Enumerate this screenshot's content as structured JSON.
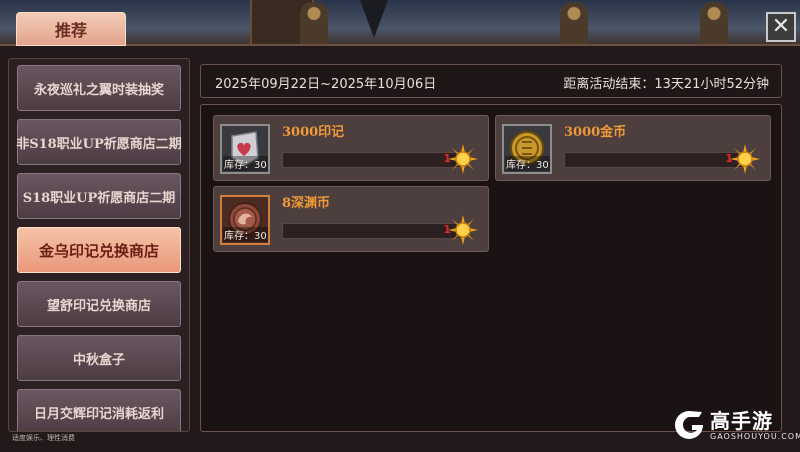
{
  "tab": {
    "label": "推荐"
  },
  "close": {
    "glyph": "✕"
  },
  "sidebar": {
    "items": [
      {
        "label": "永夜巡礼之翼时装抽奖",
        "active": false
      },
      {
        "label": "非S18职业UP祈愿商店二期",
        "active": false
      },
      {
        "label": "S18职业UP祈愿商店二期",
        "active": false
      },
      {
        "label": "金乌印记兑换商店",
        "active": true
      },
      {
        "label": "望舒印记兑换商店",
        "active": false
      },
      {
        "label": "中秋盒子",
        "active": false
      },
      {
        "label": "日月交辉印记消耗返利",
        "active": false
      }
    ]
  },
  "event": {
    "date_range": "2025年09月22日~2025年10月06日",
    "remaining": "距离活动结束：13天21小时52分钟"
  },
  "rewards": [
    {
      "name": "3000印记",
      "stock": "库存：30",
      "qty": "1",
      "icon": "heart-seal-icon",
      "cost_icon": "sun-token-icon"
    },
    {
      "name": "3000金币",
      "stock": "库存：30",
      "qty": "1",
      "icon": "gold-coin-icon",
      "cost_icon": "sun-token-icon"
    },
    {
      "name": "8深渊币",
      "stock": "库存：30",
      "qty": "1",
      "icon": "abyss-coin-icon",
      "cost_icon": "sun-token-icon"
    }
  ],
  "footer": {
    "note": "适度娱乐、理性消费"
  },
  "watermark": {
    "cn": "高手游",
    "en": "GAOSHOUYOU.COM"
  },
  "colors": {
    "accent": "#e9987a",
    "item_name": "#f09a3a",
    "qty": "#e02a2a"
  }
}
